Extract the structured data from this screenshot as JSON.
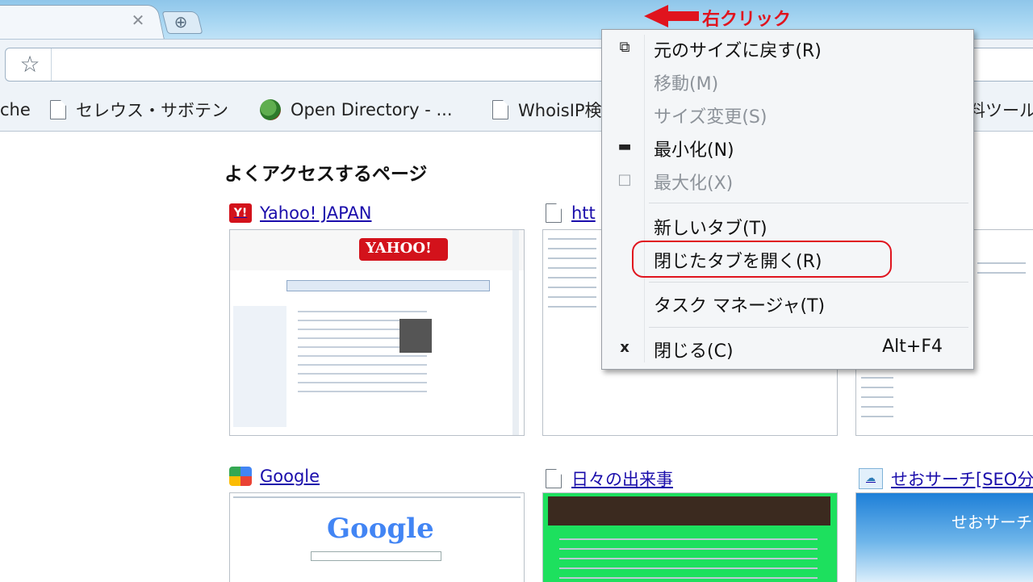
{
  "annotation": {
    "label": "右クリック"
  },
  "bookmarks": [
    {
      "label": "che",
      "icon": "none"
    },
    {
      "label": "セレウス・サボテン",
      "icon": "page-icon"
    },
    {
      "label": "Open Directory - ...",
      "icon": "dmoz-icon"
    },
    {
      "label": "WhoisIP検",
      "icon": "page-icon"
    },
    {
      "label": "料ツール",
      "icon": "none"
    }
  ],
  "ntp": {
    "title": "よくアクセスするページ",
    "sites": [
      {
        "label": "Yahoo! JAPAN",
        "icon": "yahoo-icon"
      },
      {
        "label": "htt",
        "icon": "page-icon"
      },
      {
        "label": "Google",
        "icon": "google-icon"
      },
      {
        "label": "日々の出来事",
        "icon": "page-icon"
      },
      {
        "label": "せおサーチ[SEO分",
        "icon": "seo-icon"
      }
    ],
    "thumb_text": {
      "yahoo_logo": "YAHOO!",
      "google_logo": "Google",
      "seo_title": "せおサーチ"
    }
  },
  "context_menu": {
    "items": [
      {
        "label": "元のサイズに戻す(R)",
        "icon": "restore-icon",
        "enabled": true
      },
      {
        "label": "移動(M)",
        "icon": "",
        "enabled": false
      },
      {
        "label": "サイズ変更(S)",
        "icon": "",
        "enabled": false
      },
      {
        "label": "最小化(N)",
        "icon": "minimize-icon",
        "enabled": true
      },
      {
        "label": "最大化(X)",
        "icon": "maximize-icon",
        "enabled": false
      },
      {
        "label": "新しいタブ(T)",
        "icon": "",
        "enabled": true
      },
      {
        "label": "閉じたタブを開く(R)",
        "icon": "",
        "enabled": true,
        "highlighted": true
      },
      {
        "label": "タスク マネージャ(T)",
        "icon": "",
        "enabled": true
      },
      {
        "label": "閉じる(C)",
        "icon": "close-icon",
        "enabled": true,
        "shortcut": "Alt+F4"
      }
    ]
  },
  "colors": {
    "annotation_red": "#e0141e",
    "link_blue": "#1a0dab",
    "titlebar_blue": "#a7d6f2"
  }
}
